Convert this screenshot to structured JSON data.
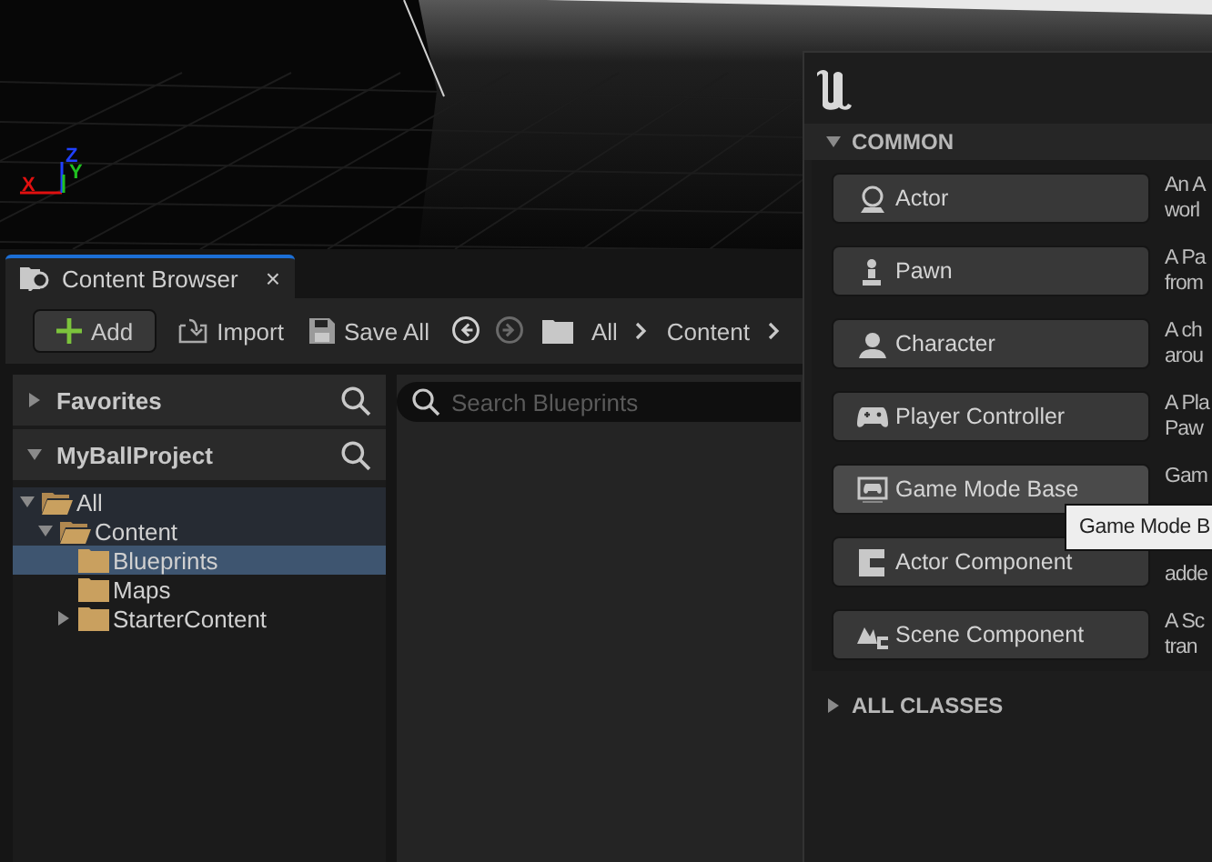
{
  "viewport": {
    "axes": [
      {
        "label": "X",
        "color": "#e01010"
      },
      {
        "label": "Y",
        "color": "#20c020"
      },
      {
        "label": "Z",
        "color": "#2040ff"
      }
    ]
  },
  "content_browser": {
    "tab": {
      "label": "Content Browser",
      "close": "×",
      "selected": true
    },
    "toolbar": [
      {
        "kind": "add",
        "label": "Add"
      },
      {
        "kind": "import",
        "label": "Import"
      },
      {
        "kind": "save",
        "label": "Save All"
      }
    ],
    "nav": [
      {
        "kind": "back",
        "disabled": false
      },
      {
        "kind": "forward",
        "disabled": true
      }
    ],
    "breadcrumb": [
      "All",
      "Content"
    ],
    "sections": [
      {
        "label": "Favorites",
        "expanded": false
      },
      {
        "label": "MyBallProject",
        "expanded": true
      }
    ],
    "tree": [
      {
        "label": "All",
        "expanded": true,
        "selected": false,
        "children": [
          {
            "label": "Content",
            "expanded": true,
            "selected": false,
            "children": [
              {
                "label": "Blueprints",
                "selected": true
              },
              {
                "label": "Maps",
                "selected": false
              },
              {
                "label": "StarterContent",
                "selected": false,
                "expanded": false
              }
            ]
          }
        ]
      }
    ],
    "search": {
      "placeholder": "Search Blueprints"
    }
  },
  "class_picker": {
    "section": {
      "label": "COMMON",
      "expanded": true
    },
    "classes": [
      {
        "label": "Actor",
        "kind": "actor",
        "hovered": false,
        "description": {
          "line_1": "An A",
          "line_2": "worl"
        }
      },
      {
        "label": "Pawn",
        "kind": "pawn",
        "hovered": false,
        "description": {
          "line_1": "A Pa",
          "line_2": "from"
        }
      },
      {
        "label": "Character",
        "kind": "character",
        "hovered": false,
        "description": {
          "line_1": "A ch",
          "line_2": "arou"
        }
      },
      {
        "label": "Player Controller",
        "kind": "controller",
        "hovered": false,
        "description": {
          "line_1": "A Pla",
          "line_2": "Paw"
        }
      },
      {
        "label": "Game Mode Base",
        "kind": "gamemode",
        "hovered": true,
        "description": {
          "line_1": "Gam"
        }
      },
      {
        "label": "Actor Component",
        "kind": "component",
        "hovered": false,
        "description": {
          "line_2": "adde"
        }
      },
      {
        "label": "Scene Component",
        "kind": "scene",
        "hovered": false,
        "description": {
          "line_1": "A Sc",
          "line_2": "tran"
        }
      }
    ],
    "footer": {
      "label": "ALL CLASSES",
      "expanded": false
    },
    "tooltip": "Game Mode B"
  }
}
